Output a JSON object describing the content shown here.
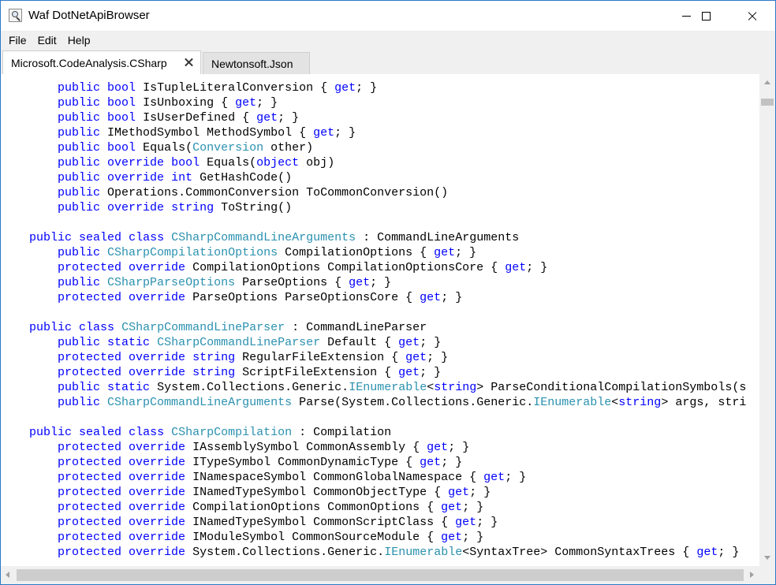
{
  "window": {
    "title": "Waf DotNetApiBrowser"
  },
  "menu": [
    "File",
    "Edit",
    "Help"
  ],
  "tabs": [
    {
      "label": "Microsoft.CodeAnalysis.CSharp",
      "active": true
    },
    {
      "label": "Newtonsoft.Json",
      "active": false
    }
  ],
  "icons": {
    "app": "magnifier-document-icon",
    "minimize": "minimize-icon",
    "maximize": "maximize-icon",
    "close": "close-icon",
    "tab_close": "close-icon"
  },
  "colors": {
    "keyword": "#0000ff",
    "type": "#2b91af",
    "text": "#000000",
    "title_border": "#2b79c7"
  },
  "code_lines": [
    "        public bool IsTupleLiteralConversion { get; }",
    "        public bool IsUnboxing { get; }",
    "        public bool IsUserDefined { get; }",
    "        public IMethodSymbol MethodSymbol { get; }",
    "        public bool Equals(Conversion other)",
    "        public override bool Equals(object obj)",
    "        public override int GetHashCode()",
    "        public Operations.CommonConversion ToCommonConversion()",
    "        public override string ToString()",
    "",
    "    public sealed class CSharpCommandLineArguments : CommandLineArguments",
    "        public CSharpCompilationOptions CompilationOptions { get; }",
    "        protected override CompilationOptions CompilationOptionsCore { get; }",
    "        public CSharpParseOptions ParseOptions { get; }",
    "        protected override ParseOptions ParseOptionsCore { get; }",
    "",
    "    public class CSharpCommandLineParser : CommandLineParser",
    "        public static CSharpCommandLineParser Default { get; }",
    "        protected override string RegularFileExtension { get; }",
    "        protected override string ScriptFileExtension { get; }",
    "        public static System.Collections.Generic.IEnumerable<string> ParseConditionalCompilationSymbols(s",
    "        public CSharpCommandLineArguments Parse(System.Collections.Generic.IEnumerable<string> args, stri",
    "",
    "    public sealed class CSharpCompilation : Compilation",
    "        protected override IAssemblySymbol CommonAssembly { get; }",
    "        protected override ITypeSymbol CommonDynamicType { get; }",
    "        protected override INamespaceSymbol CommonGlobalNamespace { get; }",
    "        protected override INamedTypeSymbol CommonObjectType { get; }",
    "        protected override CompilationOptions CommonOptions { get; }",
    "        protected override INamedTypeSymbol CommonScriptClass { get; }",
    "        protected override IModuleSymbol CommonSourceModule { get; }",
    "        protected override System.Collections.Generic.IEnumerable<SyntaxTree> CommonSyntaxTrees { get; }"
  ],
  "keywords": [
    "public",
    "protected",
    "override",
    "bool",
    "int",
    "string",
    "object",
    "sealed",
    "class",
    "static",
    "get"
  ],
  "type_names": [
    "Conversion",
    "CSharpCommandLineArguments",
    "CSharpCompilationOptions",
    "CSharpParseOptions",
    "CSharpCommandLineParser",
    "IEnumerable",
    "CSharpCompilation"
  ]
}
